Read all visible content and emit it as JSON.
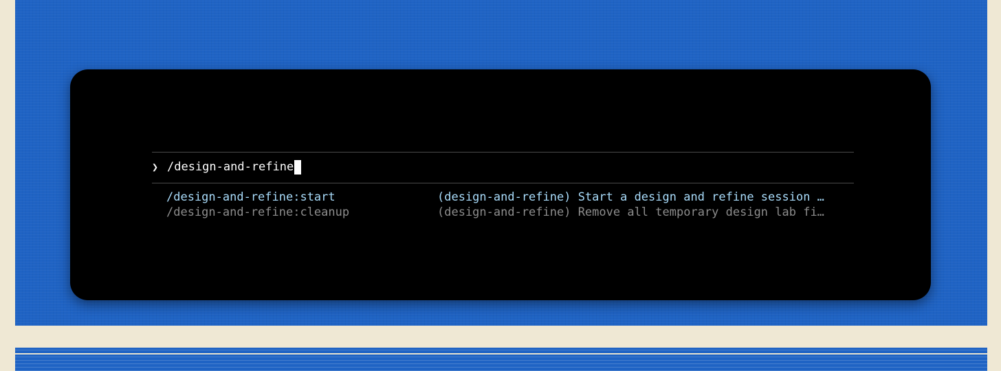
{
  "prompt": {
    "symbol": "❯",
    "input_value": "/design-and-refine"
  },
  "suggestions": [
    {
      "command": "/design-and-refine:start",
      "description": "(design-and-refine) Start a design and refine session …",
      "selected": true
    },
    {
      "command": "/design-and-refine:cleanup",
      "description": "(design-and-refine) Remove all temporary design lab fi…",
      "selected": false
    }
  ],
  "colors": {
    "terminal_bg": "#000000",
    "selected_text": "#a9dcfb",
    "dim_text": "#8d8d8d",
    "background_blue": "#1f63c4",
    "background_cream": "#efe8d4"
  }
}
